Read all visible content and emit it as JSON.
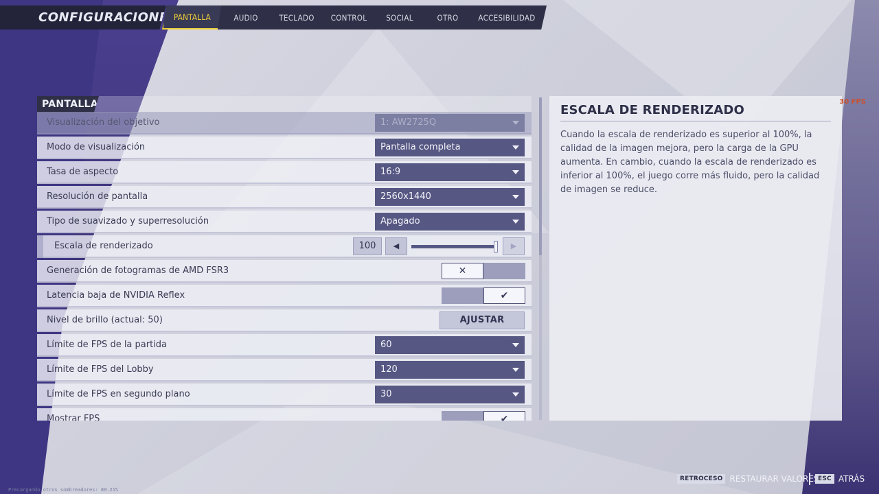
{
  "header": {
    "title": "CONFIGURACIONES",
    "tabs": [
      {
        "label": "PANTALLA",
        "active": true
      },
      {
        "label": "AUDIO",
        "active": false
      },
      {
        "label": "TECLADO",
        "active": false
      },
      {
        "label": "CONTROL",
        "active": false
      },
      {
        "label": "SOCIAL",
        "active": false
      },
      {
        "label": "OTRO",
        "active": false
      },
      {
        "label": "ACCESIBILIDAD",
        "active": false
      }
    ]
  },
  "section": {
    "title": "PANTALLA"
  },
  "settings": [
    {
      "label": "Visualización del objetivo",
      "type": "dropdown",
      "value": "1: AW2725Q",
      "disabled": true
    },
    {
      "label": "Modo de visualización",
      "type": "dropdown",
      "value": "Pantalla completa"
    },
    {
      "label": "Tasa de aspecto",
      "type": "dropdown",
      "value": "16:9"
    },
    {
      "label": "Resolución de pantalla",
      "type": "dropdown",
      "value": "2560x1440"
    },
    {
      "label": "Tipo de suavizado y superresolución",
      "type": "dropdown",
      "value": "Apagado"
    },
    {
      "label": "Escala de renderizado",
      "type": "slider",
      "value": "100",
      "fraction": 1.0,
      "sub": true
    },
    {
      "label": "Generación de fotogramas de AMD FSR3",
      "type": "toggle",
      "on": false
    },
    {
      "label": "Latencia baja de NVIDIA Reflex",
      "type": "toggle",
      "on": true
    },
    {
      "label": "Nivel de brillo (actual: 50)",
      "type": "button",
      "button_label": "AJUSTAR"
    },
    {
      "label": "Límite de FPS de la partida",
      "type": "dropdown",
      "value": "60"
    },
    {
      "label": "Límite de FPS del Lobby",
      "type": "dropdown",
      "value": "120"
    },
    {
      "label": "Límite de FPS en segundo plano",
      "type": "dropdown",
      "value": "30"
    },
    {
      "label": "Mostrar FPS",
      "type": "toggle",
      "on": true
    }
  ],
  "info": {
    "title": "ESCALA DE RENDERIZADO",
    "body": "Cuando la escala de renderizado es superior al 100%, la calidad de la imagen mejora, pero la carga de la GPU aumenta. En cambio, cuando la escala de renderizado es inferior al 100%, el juego corre más fluido, pero la calidad de imagen se reduce."
  },
  "fps_counter": "30 FPS",
  "footer": {
    "restore_key": "RETROCESO",
    "restore_label": "RESTAURAR VALORES",
    "back_key": "ESC",
    "back_label": "ATRÁS",
    "debug_text": "Precargando otros sombreadores: 80.21%"
  },
  "colors": {
    "accent": "#f2d236",
    "topbar": "#2f3047",
    "dropdown": "#565782",
    "fps": "#c9502e"
  }
}
